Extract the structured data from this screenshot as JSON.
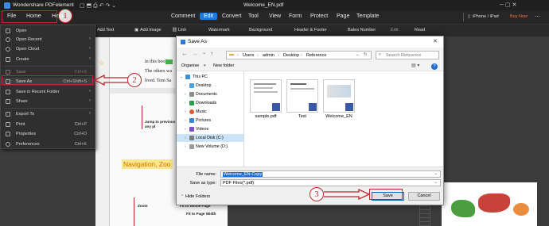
{
  "app": {
    "name": "Wondershare PDFelement",
    "document_title": "Welcome_EN.pdf",
    "device": "iPhone / iPad",
    "buy": "Buy Now"
  },
  "menubar": {
    "file": "File",
    "home": "Home",
    "help": "Help",
    "tabs": [
      "Comment",
      "Edit",
      "Convert",
      "Tool",
      "View",
      "Form",
      "Protect",
      "Page",
      "Template"
    ]
  },
  "toolbar": {
    "add_text": "Add Text",
    "add_image": "Add Image",
    "link": "Link",
    "watermark": "Watermark",
    "background": "Background",
    "header_footer": "Header & Footer",
    "bates": "Bates Number",
    "edit": "Edit",
    "read": "Read"
  },
  "file_menu": {
    "items": [
      {
        "label": "Open",
        "shortcut": ""
      },
      {
        "label": "Open Recent",
        "shortcut": ""
      },
      {
        "label": "Open Cloud",
        "shortcut": ""
      },
      {
        "label": "Create",
        "shortcut": ""
      },
      {
        "label": "Save",
        "shortcut": "Ctrl+S"
      },
      {
        "label": "Save As",
        "shortcut": "Ctrl+Shift+S"
      },
      {
        "label": "Save in Recent Folder",
        "shortcut": ""
      },
      {
        "label": "Share",
        "shortcut": ""
      },
      {
        "label": "Export To",
        "shortcut": ""
      },
      {
        "label": "Print",
        "shortcut": "Ctrl+P"
      },
      {
        "label": "Properties",
        "shortcut": "Ctrl+D"
      },
      {
        "label": "Preferences",
        "shortcut": "Ctrl+K"
      }
    ]
  },
  "document": {
    "line1": "in this book",
    "line2": "The others wa",
    "line3": "lived. Tom Sa",
    "jump_note": "Jump to previous containing any pl",
    "heading": "Navigation, Zoo",
    "zoom": "Zoom",
    "fit_whole": "Fit to Whole Page",
    "fit_width": "Fit to Page Width"
  },
  "dialog": {
    "title": "Save As",
    "breadcrumb": [
      "Users",
      "admin",
      "Desktop",
      "Reference"
    ],
    "search_placeholder": "Search Reference",
    "organise": "Organise",
    "new_folder": "New folder",
    "nav_items": [
      "This PC",
      "Desktop",
      "Documents",
      "Downloads",
      "Music",
      "Pictures",
      "Videos",
      "Local Disk (C:)",
      "New Volume (D:)"
    ],
    "files": [
      "sample.pdf",
      "Test",
      "Welcome_EN"
    ],
    "file_name_label": "File name:",
    "file_name_value": "Welcome_EN-Copy",
    "save_type_label": "Save as type:",
    "save_type_value": "PDF Files(*.pdf)",
    "hide_folders": "Hide Folders",
    "save": "Save",
    "cancel": "Cancel"
  },
  "annotations": {
    "step1": "1",
    "step2": "2",
    "step3": "3",
    "color": "#c1272d"
  }
}
